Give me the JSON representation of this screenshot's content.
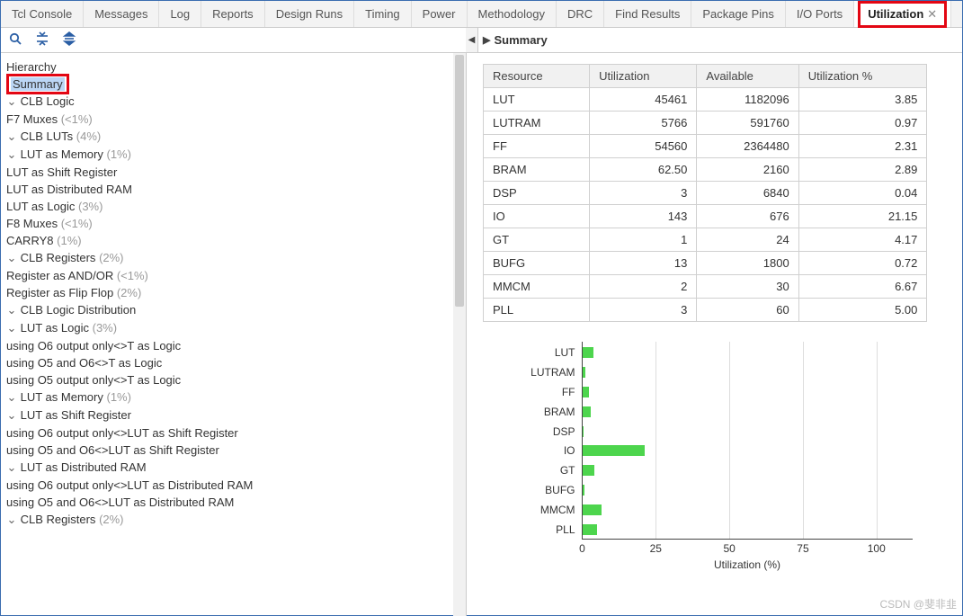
{
  "tabs": {
    "items": [
      "Tcl Console",
      "Messages",
      "Log",
      "Reports",
      "Design Runs",
      "Timing",
      "Power",
      "Methodology",
      "DRC",
      "Find Results",
      "Package Pins",
      "I/O Ports",
      "Utilization"
    ],
    "active": "Utilization"
  },
  "left": {
    "hierarchy_label": "Hierarchy",
    "summary_label": "Summary",
    "tree": [
      {
        "lvl": 1,
        "ch": "v",
        "t": "CLB Logic"
      },
      {
        "lvl": 3,
        "t": "F7 Muxes",
        "p": "(<1%)"
      },
      {
        "lvl": 3,
        "ch": "v",
        "t": "CLB LUTs",
        "p": "(4%)"
      },
      {
        "lvl": 4,
        "ch": "v",
        "t": "LUT as Memory",
        "p": "(1%)"
      },
      {
        "lvl": 5,
        "t": "LUT as Shift Register"
      },
      {
        "lvl": 5,
        "t": "LUT as Distributed RAM"
      },
      {
        "lvl": 4,
        "t": "LUT as Logic",
        "p": "(3%)"
      },
      {
        "lvl": 3,
        "t": "F8 Muxes",
        "p": "(<1%)"
      },
      {
        "lvl": 3,
        "t": "CARRY8",
        "p": "(1%)"
      },
      {
        "lvl": 3,
        "ch": "v",
        "t": "CLB Registers",
        "p": "(2%)"
      },
      {
        "lvl": 4,
        "t": "Register as AND/OR",
        "p": "(<1%)"
      },
      {
        "lvl": 4,
        "t": "Register as Flip Flop",
        "p": "(2%)"
      },
      {
        "lvl": 1,
        "ch": "v",
        "t": "CLB Logic Distribution"
      },
      {
        "lvl": 2,
        "ch": "v",
        "t": "LUT as Logic",
        "p": "(3%)"
      },
      {
        "lvl": 4,
        "t": "using O6 output only<>T as Logic"
      },
      {
        "lvl": 4,
        "t": "using O5 and O6<>T as Logic"
      },
      {
        "lvl": 4,
        "t": "using O5 output only<>T as Logic"
      },
      {
        "lvl": 2,
        "ch": "v",
        "t": "LUT as Memory",
        "p": "(1%)"
      },
      {
        "lvl": 3,
        "ch": "v",
        "t": "LUT as Shift Register"
      },
      {
        "lvl": 5,
        "t": "using O6 output only<>LUT as Shift Register"
      },
      {
        "lvl": 5,
        "t": "using O5 and O6<>LUT as Shift Register"
      },
      {
        "lvl": 3,
        "ch": "v",
        "t": "LUT as Distributed RAM"
      },
      {
        "lvl": 5,
        "t": "using O6 output only<>LUT as Distributed RAM"
      },
      {
        "lvl": 5,
        "t": "using O5 and O6<>LUT as Distributed RAM"
      },
      {
        "lvl": 2,
        "ch": "v",
        "t": "CLB Registers",
        "p": "(2%)"
      }
    ]
  },
  "right": {
    "title": "Summary",
    "table": {
      "headers": [
        "Resource",
        "Utilization",
        "Available",
        "Utilization %"
      ],
      "rows": [
        [
          "LUT",
          "45461",
          "1182096",
          "3.85"
        ],
        [
          "LUTRAM",
          "5766",
          "591760",
          "0.97"
        ],
        [
          "FF",
          "54560",
          "2364480",
          "2.31"
        ],
        [
          "BRAM",
          "62.50",
          "2160",
          "2.89"
        ],
        [
          "DSP",
          "3",
          "6840",
          "0.04"
        ],
        [
          "IO",
          "143",
          "676",
          "21.15"
        ],
        [
          "GT",
          "1",
          "24",
          "4.17"
        ],
        [
          "BUFG",
          "13",
          "1800",
          "0.72"
        ],
        [
          "MMCM",
          "2",
          "30",
          "6.67"
        ],
        [
          "PLL",
          "3",
          "60",
          "5.00"
        ]
      ]
    }
  },
  "chart_data": {
    "type": "bar",
    "orientation": "horizontal",
    "categories": [
      "LUT",
      "LUTRAM",
      "FF",
      "BRAM",
      "DSP",
      "IO",
      "GT",
      "BUFG",
      "MMCM",
      "PLL"
    ],
    "values": [
      3.85,
      0.97,
      2.31,
      2.89,
      0.04,
      21.15,
      4.17,
      0.72,
      6.67,
      5.0
    ],
    "xlabel": "Utilization (%)",
    "xlim": [
      0,
      110
    ],
    "xticks": [
      0,
      25,
      50,
      75,
      100
    ],
    "bar_color": "#4dd54d"
  },
  "watermark": "CSDN @斐非韭"
}
